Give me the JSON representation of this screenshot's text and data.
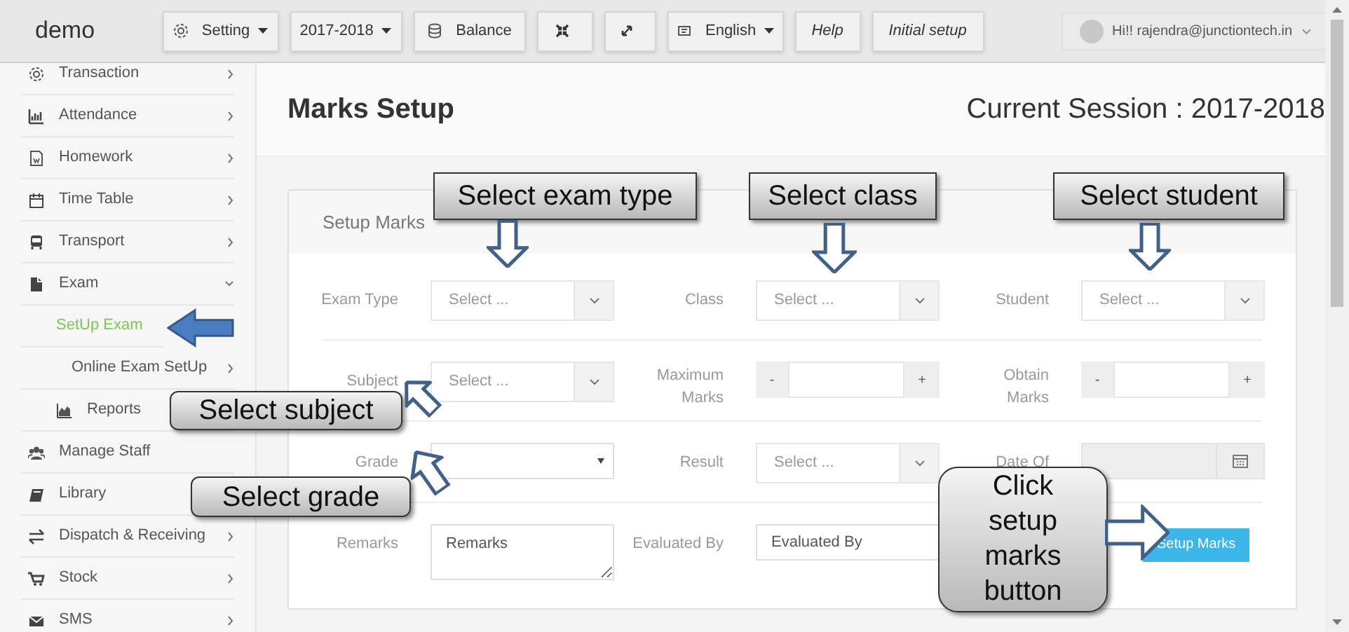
{
  "topbar": {
    "brand": "demo",
    "buttons": [
      {
        "kind": "dropdown",
        "label": "Setting"
      },
      {
        "kind": "dropdown",
        "label": "2017-2018"
      },
      {
        "kind": "button",
        "label": "Balance"
      },
      {
        "kind": "icon"
      },
      {
        "kind": "icon"
      },
      {
        "kind": "dropdown",
        "label": "English"
      },
      {
        "kind": "link",
        "label": "Help"
      },
      {
        "kind": "link",
        "label": "Initial setup"
      }
    ],
    "user": {
      "greeting": "Hi!! rajendra@junctiontech.in"
    }
  },
  "sidebar": {
    "items": [
      {
        "label": "Transaction",
        "selected": false,
        "expanded": false
      },
      {
        "label": "Attendance",
        "selected": false,
        "expanded": false
      },
      {
        "label": "Homework",
        "selected": false,
        "expanded": false
      },
      {
        "label": "Time Table",
        "selected": false,
        "expanded": false
      },
      {
        "label": "Transport",
        "selected": false,
        "expanded": false
      },
      {
        "label": "Exam",
        "selected": false,
        "expanded": true,
        "children": [
          {
            "label": "SetUp Exam",
            "selected": true
          },
          {
            "label": "Online Exam SetUp",
            "selected": false,
            "expanded": false
          },
          {
            "label": "Reports",
            "selected": false
          }
        ]
      },
      {
        "label": "Manage Staff",
        "selected": false
      },
      {
        "label": "Library",
        "selected": false
      },
      {
        "label": "Dispatch & Receiving",
        "selected": false,
        "expanded": false
      },
      {
        "label": "Stock",
        "selected": false,
        "expanded": false
      },
      {
        "label": "SMS",
        "selected": false,
        "expanded": false
      }
    ]
  },
  "page": {
    "title": "Marks Setup",
    "session": "Current Session : 2017-2018"
  },
  "panel": {
    "title": "Setup Marks",
    "rows": [
      [
        {
          "kind": "select",
          "label": "Exam Type",
          "placeholder": "Select ..."
        },
        {
          "kind": "select",
          "label": "Class",
          "placeholder": "Select ..."
        },
        {
          "kind": "select",
          "label": "Student",
          "placeholder": "Select ..."
        }
      ],
      [
        {
          "kind": "select",
          "label": "Subject",
          "placeholder": "Select ..."
        },
        {
          "kind": "stepper",
          "label": "Maximum Marks",
          "minus": "-",
          "plus": "+"
        },
        {
          "kind": "stepper",
          "label": "Obtain Marks",
          "minus": "-",
          "plus": "+"
        }
      ],
      [
        {
          "kind": "dropdown",
          "label": "Grade"
        },
        {
          "kind": "select",
          "label": "Result",
          "placeholder": "Select ..."
        },
        {
          "kind": "date",
          "label": "Date Of"
        }
      ],
      [
        {
          "kind": "textarea",
          "label": "Remarks",
          "placeholder": "Remarks"
        },
        {
          "kind": "text",
          "label": "Evaluated By",
          "placeholder": "Evaluated By"
        },
        {
          "kind": "button",
          "label": "Setup Marks"
        }
      ]
    ]
  },
  "callouts": [
    {
      "kind": "box",
      "text": "Select exam type"
    },
    {
      "kind": "box",
      "text": "Select class"
    },
    {
      "kind": "box",
      "text": "Select student"
    },
    {
      "kind": "rounded",
      "text": "Select subject"
    },
    {
      "kind": "rounded",
      "text": "Select grade"
    },
    {
      "kind": "rounded",
      "text": "Click setup marks button"
    }
  ]
}
